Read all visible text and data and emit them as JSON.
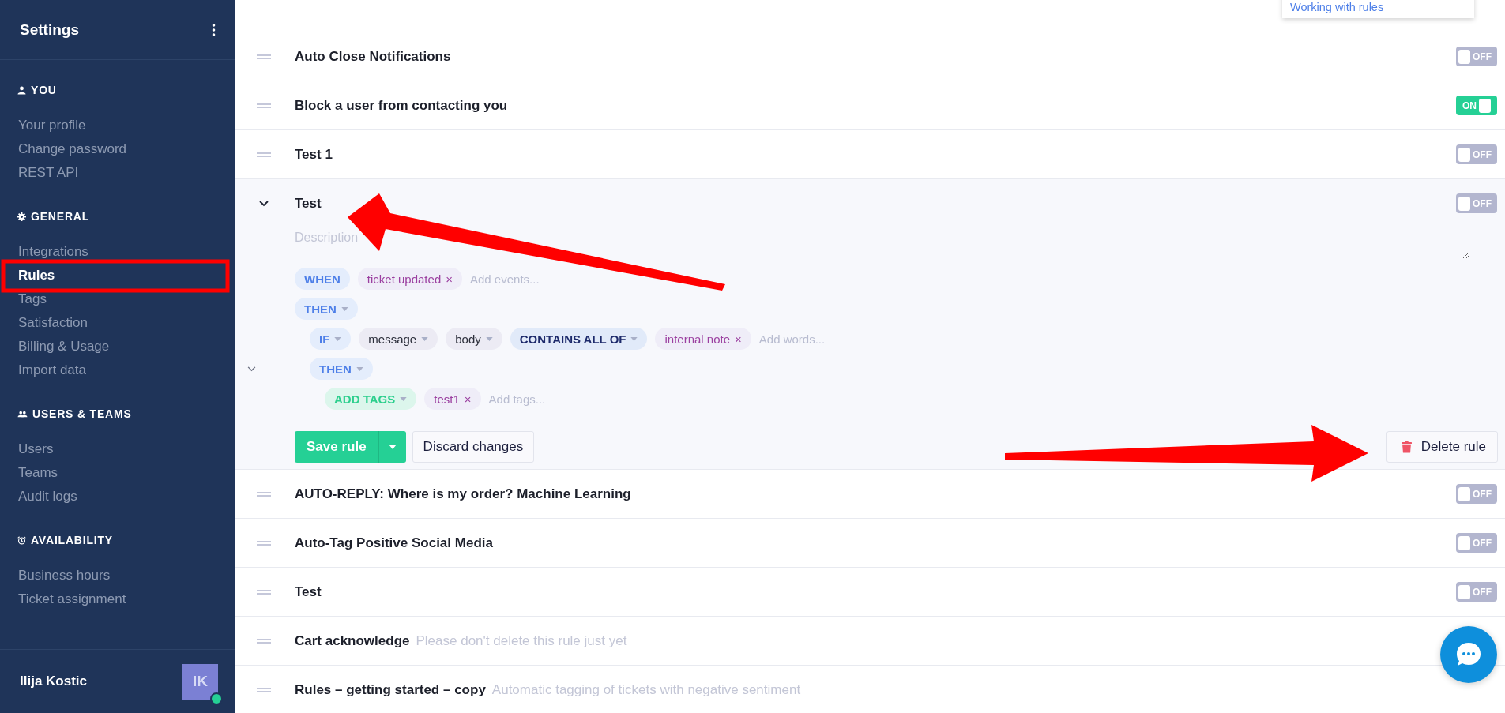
{
  "sidebar": {
    "title": "Settings",
    "sections": [
      {
        "heading": "YOU",
        "items": [
          {
            "label": "Your profile",
            "selected": false
          },
          {
            "label": "Change password",
            "selected": false
          },
          {
            "label": "REST API",
            "selected": false
          }
        ]
      },
      {
        "heading": "GENERAL",
        "items": [
          {
            "label": "Integrations",
            "selected": false
          },
          {
            "label": "Rules",
            "selected": true
          },
          {
            "label": "Tags",
            "selected": false
          },
          {
            "label": "Satisfaction",
            "selected": false
          },
          {
            "label": "Billing & Usage",
            "selected": false
          },
          {
            "label": "Import data",
            "selected": false
          }
        ]
      },
      {
        "heading": "USERS & TEAMS",
        "items": [
          {
            "label": "Users",
            "selected": false
          },
          {
            "label": "Teams",
            "selected": false
          },
          {
            "label": "Audit logs",
            "selected": false
          }
        ]
      },
      {
        "heading": "AVAILABILITY",
        "items": [
          {
            "label": "Business hours",
            "selected": false
          },
          {
            "label": "Ticket assignment",
            "selected": false
          }
        ]
      }
    ],
    "user": {
      "name": "Ilija Kostic",
      "initials": "IK",
      "online": true
    }
  },
  "help_menu": {
    "link": "Working with rules"
  },
  "rules": [
    {
      "title": "Auto Close Notifications",
      "expanded": false,
      "on": false,
      "switch_label": "OFF"
    },
    {
      "title": "Block a user from contacting you",
      "expanded": false,
      "on": true,
      "switch_label": "ON"
    },
    {
      "title": "Test 1",
      "expanded": false,
      "on": false,
      "switch_label": "OFF"
    },
    {
      "title": "Test",
      "expanded": true,
      "on": false,
      "switch_label": "OFF"
    },
    {
      "title": "AUTO-REPLY: Where is my order? Machine Learning",
      "expanded": false,
      "on": false,
      "switch_label": "OFF"
    },
    {
      "title": "Auto-Tag Positive Social Media",
      "expanded": false,
      "on": false,
      "switch_label": "OFF"
    },
    {
      "title": "Test",
      "expanded": false,
      "on": false,
      "switch_label": "OFF"
    },
    {
      "title": "Cart acknowledge",
      "description": "Please don't delete this rule just yet",
      "expanded": false
    },
    {
      "title": "Rules – getting started – copy",
      "description": "Automatic tagging of tickets with negative sentiment",
      "expanded": false
    }
  ],
  "rule_editor": {
    "description": {
      "placeholder": "Description"
    },
    "lines": [
      {
        "chips": [
          {
            "kind": "keyword",
            "label": "WHEN",
            "dropdown": false
          },
          {
            "kind": "value",
            "label": "ticket updated",
            "remove": "×"
          },
          {
            "kind": "input",
            "placeholder": "Add events..."
          }
        ]
      },
      {
        "chips": [
          {
            "kind": "keyword",
            "label": "THEN",
            "dropdown": true
          }
        ],
        "children": [
          {
            "chips": [
              {
                "kind": "keyword",
                "label": "IF",
                "dropdown": true
              },
              {
                "kind": "select",
                "label": "message",
                "dropdown": true
              },
              {
                "kind": "select",
                "label": "body",
                "dropdown": true
              },
              {
                "kind": "operator",
                "label": "CONTAINS ALL OF",
                "dropdown": true
              },
              {
                "kind": "value",
                "label": "internal note",
                "remove": "×"
              },
              {
                "kind": "input",
                "placeholder": "Add words..."
              }
            ]
          },
          {
            "collapse_toggle": true,
            "chips": [
              {
                "kind": "keyword",
                "label": "THEN",
                "dropdown": true
              }
            ],
            "children": [
              {
                "chips": [
                  {
                    "kind": "action",
                    "label": "ADD TAGS",
                    "dropdown": true
                  },
                  {
                    "kind": "value",
                    "label": "test1",
                    "remove": "×"
                  },
                  {
                    "kind": "input",
                    "placeholder": "Add tags..."
                  }
                ]
              }
            ]
          }
        ]
      }
    ],
    "buttons": {
      "save": "Save rule",
      "discard": "Discard changes",
      "delete": "Delete rule"
    }
  }
}
